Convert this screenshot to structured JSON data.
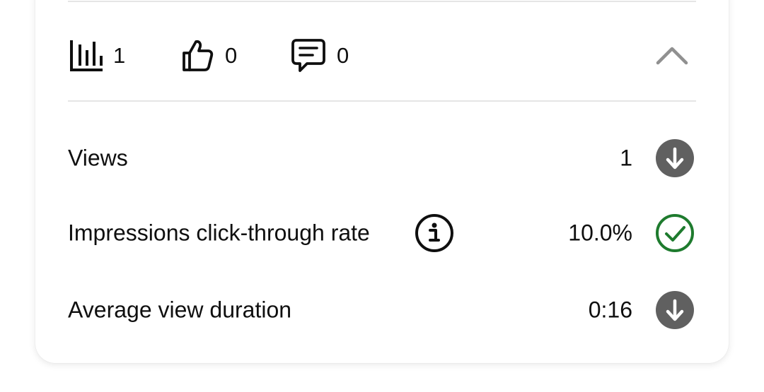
{
  "stats": {
    "views_count": "1",
    "likes_count": "0",
    "comments_count": "0"
  },
  "metrics": [
    {
      "label": "Views",
      "value": "1",
      "status": "below-typical"
    },
    {
      "label": "Impressions click-through rate",
      "value": "10.0%",
      "status": "typical"
    },
    {
      "label": "Average view duration",
      "value": "0:16",
      "status": "below-typical"
    }
  ],
  "icons": {
    "views": "bar-chart-icon",
    "likes": "thumbs-up-icon",
    "comments": "comment-icon",
    "collapse": "chevron-up-icon",
    "info": "info-icon",
    "down": "arrow-down-circle-icon",
    "check": "check-circle-icon"
  },
  "colors": {
    "text": "#0f0f0f",
    "divider": "#e5e5e5",
    "down_badge": "#606060",
    "check_green": "#1e7b2e",
    "chevron": "#909090"
  }
}
